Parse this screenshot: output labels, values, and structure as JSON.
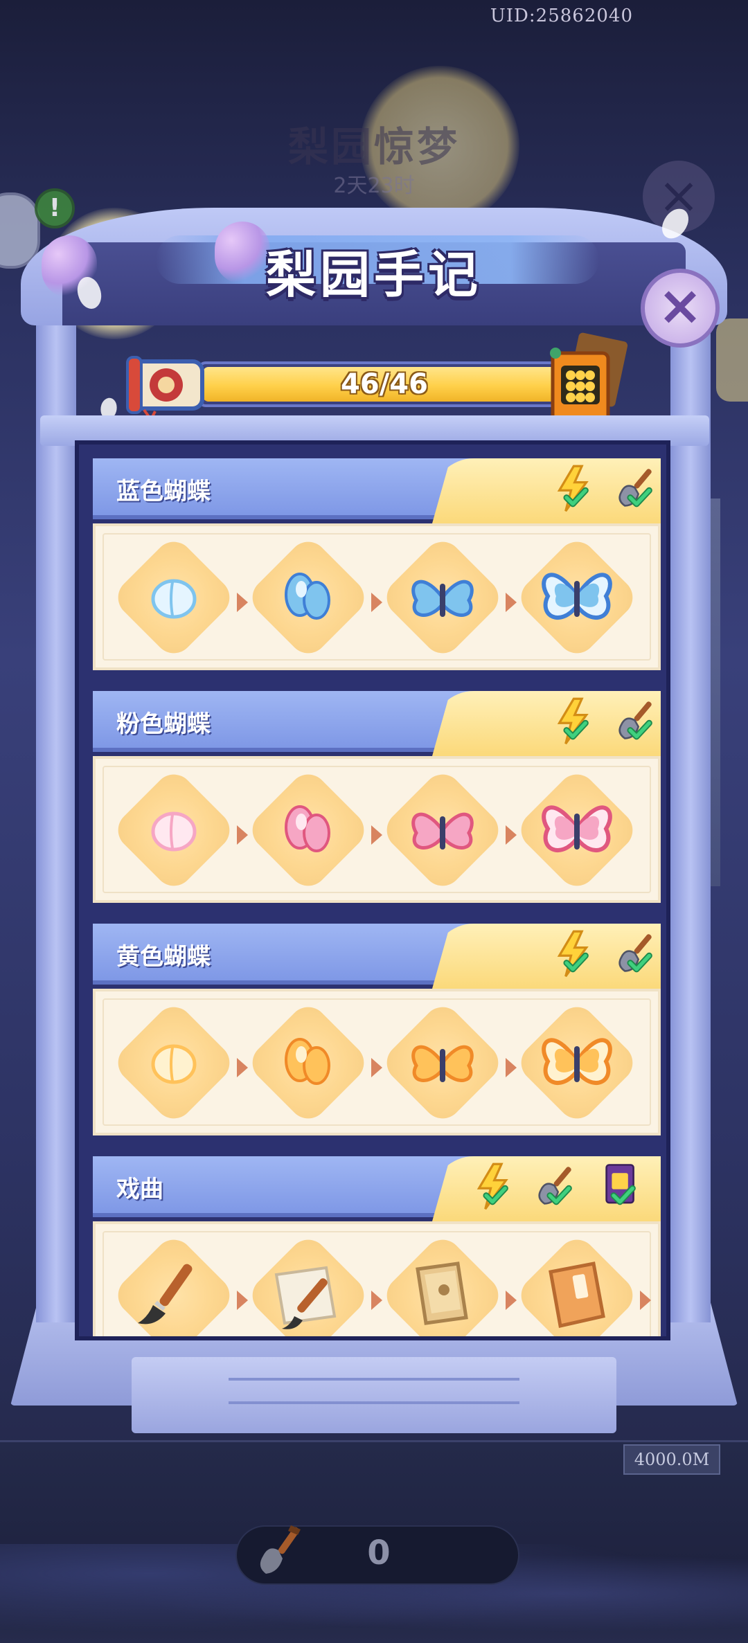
{
  "header": {
    "uid": "UID:25862040",
    "bg_title": "梨园惊梦",
    "bg_timer": "2天23时"
  },
  "panel": {
    "title": "梨园手记",
    "progress": {
      "text": "46/46",
      "current": 46,
      "total": 46
    }
  },
  "sections": [
    {
      "title": "蓝色蝴蝶",
      "requirements": [
        "lightning-check-icon",
        "shovel-check-icon"
      ],
      "stages": [
        "blue-egg-icon",
        "blue-cocoon-icon",
        "blue-butterfly-small-icon",
        "blue-butterfly-large-icon"
      ],
      "colors": {
        "main": "#7fc4ee",
        "accent": "#3f7fd6",
        "light": "#e5f5ff"
      }
    },
    {
      "title": "粉色蝴蝶",
      "requirements": [
        "lightning-check-icon",
        "shovel-check-icon"
      ],
      "stages": [
        "pink-egg-icon",
        "pink-cocoon-icon",
        "pink-butterfly-small-icon",
        "pink-butterfly-large-icon"
      ],
      "colors": {
        "main": "#f6a6c4",
        "accent": "#e0577f",
        "light": "#ffe8f0"
      }
    },
    {
      "title": "黄色蝴蝶",
      "requirements": [
        "lightning-check-icon",
        "shovel-check-icon"
      ],
      "stages": [
        "yellow-egg-icon",
        "yellow-cocoon-icon",
        "yellow-butterfly-small-icon",
        "yellow-butterfly-large-icon"
      ],
      "colors": {
        "main": "#ffc25a",
        "accent": "#f08a28",
        "light": "#fff2cf"
      }
    },
    {
      "title": "戏曲",
      "requirements": [
        "lightning-check-icon",
        "shovel-check-icon",
        "book-check-icon"
      ],
      "stages": [
        "brush-icon",
        "scroll-brush-icon",
        "script-book-icon",
        "opera-book-icon"
      ],
      "colors": {
        "main": "#f0a35a",
        "accent": "#b86a30",
        "light": "#f5e6c9"
      }
    }
  ],
  "footer": {
    "money": "4000.0M",
    "shovel_count": "0"
  },
  "colors": {
    "frame": "#a9b4ec",
    "progress": "#ffd04a",
    "check": "#2fb56a"
  }
}
